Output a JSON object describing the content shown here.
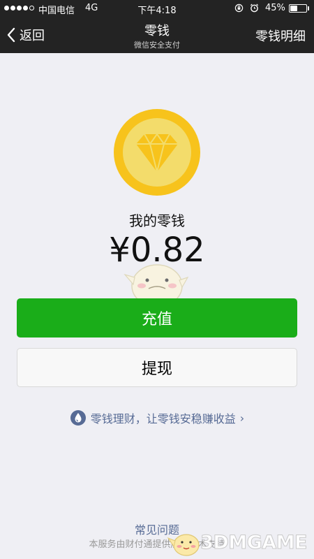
{
  "status_bar": {
    "carrier": "中国电信",
    "network": "4G",
    "time": "下午4:18",
    "battery": "45%",
    "battery_level": 0.45,
    "signal_filled": 4,
    "signal_total": 5
  },
  "nav": {
    "back_label": "返回",
    "title": "零钱",
    "subtitle": "微信安全支付",
    "right_label": "零钱明细"
  },
  "balance": {
    "label": "我的零钱",
    "amount": "¥0.82"
  },
  "actions": {
    "recharge_label": "充值",
    "withdraw_label": "提现"
  },
  "promo": {
    "text": "零钱理财，让零钱安稳赚收益",
    "chevron": "›"
  },
  "footer": {
    "faq": "常见问题",
    "note": "本服务由财付通提供底层技术支持"
  },
  "watermark": {
    "text": "3DMGAME"
  },
  "colors": {
    "primary_green": "#1aad19",
    "link_blue": "#576b95",
    "nav_background": "#232323",
    "page_background": "#efeff4",
    "coin_gold": "#f7c31c"
  },
  "icons": [
    "chevron-left-icon",
    "lock-rotation-icon",
    "alarm-icon",
    "diamond-coin-icon",
    "wealth-drop-icon"
  ]
}
